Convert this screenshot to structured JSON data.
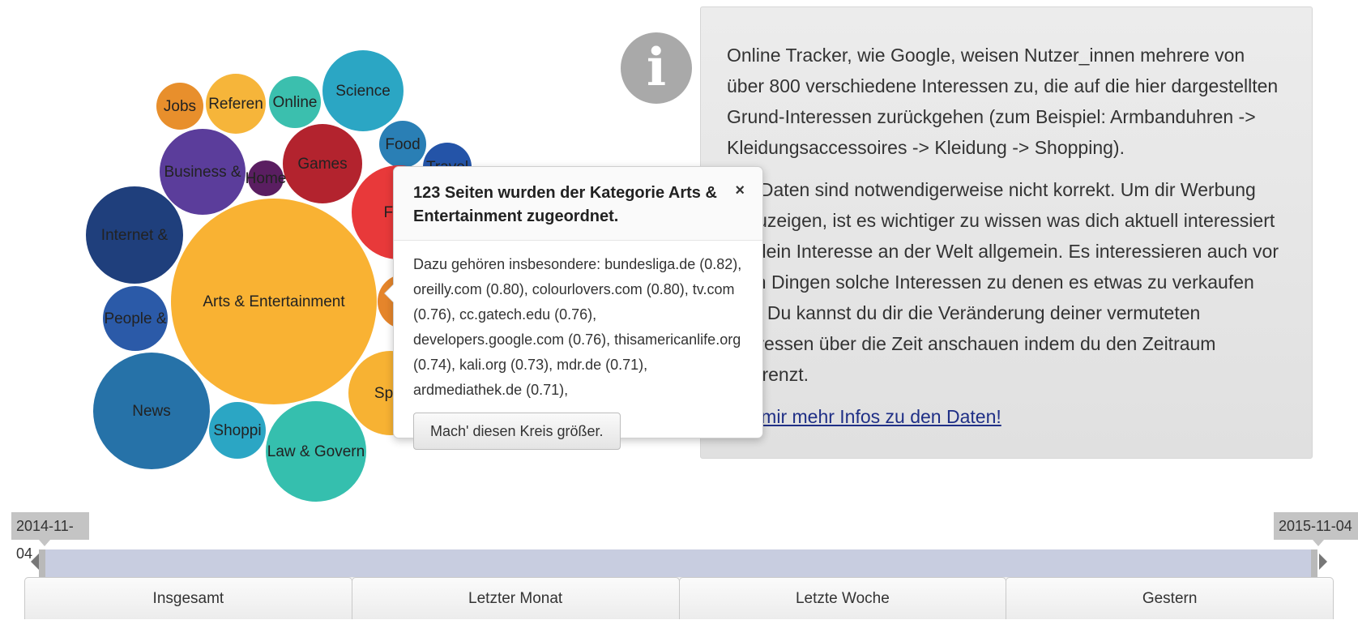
{
  "bubble_chart": {
    "bubbles": [
      {
        "label": "Arts & Entertainment",
        "color": "#f9b233",
        "value": 123
      },
      {
        "label": "News",
        "color": "#2672a8"
      },
      {
        "label": "Internet &",
        "color": "#1f3f7c"
      },
      {
        "label": "People &",
        "color": "#2b5aa8"
      },
      {
        "label": "Business &",
        "color": "#5b3d9b"
      },
      {
        "label": "Games",
        "color": "#b3232e"
      },
      {
        "label": "Science",
        "color": "#2ba6c4"
      },
      {
        "label": "Jobs",
        "color": "#e88f2c"
      },
      {
        "label": "Referen",
        "color": "#f6b53a"
      },
      {
        "label": "Online",
        "color": "#3bbfae"
      },
      {
        "label": "Home",
        "color": "#5a1e61"
      },
      {
        "label": "Food",
        "color": "#2a7fb5"
      },
      {
        "label": "Travel",
        "color": "#2454a8"
      },
      {
        "label": "Fina",
        "color": "#e8393a"
      },
      {
        "label": "Law & Govern",
        "color": "#35bfae"
      },
      {
        "label": "Shoppi",
        "color": "#2ba6c4"
      },
      {
        "label": "Spor",
        "color": "#f7b233"
      },
      {
        "label": "",
        "color": "#e5852b"
      }
    ]
  },
  "info": {
    "icon": "info-icon",
    "paragraph1": "Online Tracker, wie Google, weisen Nutzer_innen mehrere von über 800 verschiedene Interessen zu, die auf die hier dargestellten Grund-Interessen zurückgehen (zum Beispiel: Armbanduhren -> Kleidungsaccessoires -> Kleidung -> Shopping).",
    "paragraph2": "Die Daten sind notwendigerweise nicht korrekt. Um dir Werbung anzuzeigen, ist es wichtiger zu wissen was dich aktuell interessiert als dein Interesse an der Welt allgemein. Es interessieren auch vor allen Dingen solche Interessen zu denen es etwas zu verkaufen gibt. Du kannst du dir die Veränderung deiner vermuteten Interessen über die Zeit anschauen indem du den Zeitraum eingrenzt.",
    "link": "Gib mir mehr Infos zu den Daten!"
  },
  "popover": {
    "title": "123 Seiten wurden der Kategorie Arts & Entertainment zugeordnet.",
    "close": "×",
    "body": "Dazu gehören insbesondere: bundesliga.de (0.82), oreilly.com (0.80), colourlovers.com (0.80), tv.com (0.76), cc.gatech.edu (0.76), developers.google.com (0.76), thisamericanlife.org (0.74), kali.org (0.73), mdr.de (0.71), ardmediathek.de (0.71),",
    "button": "Mach' diesen Kreis größer."
  },
  "timeline": {
    "start": "2014-11-04",
    "end": "2015-11-04"
  },
  "periods": [
    "Insgesamt",
    "Letzter Monat",
    "Letzte Woche",
    "Gestern"
  ]
}
